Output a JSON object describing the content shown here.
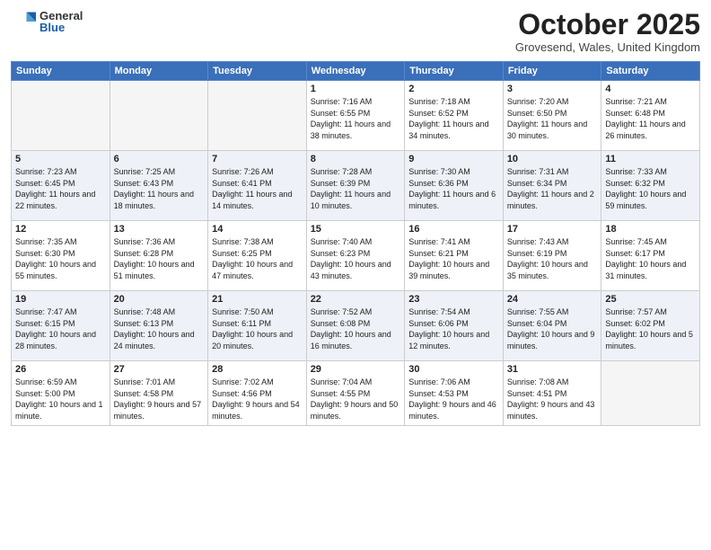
{
  "header": {
    "logo_general": "General",
    "logo_blue": "Blue",
    "month": "October 2025",
    "location": "Grovesend, Wales, United Kingdom"
  },
  "weekdays": [
    "Sunday",
    "Monday",
    "Tuesday",
    "Wednesday",
    "Thursday",
    "Friday",
    "Saturday"
  ],
  "weeks": [
    [
      {
        "day": "",
        "empty": true
      },
      {
        "day": "",
        "empty": true
      },
      {
        "day": "",
        "empty": true
      },
      {
        "day": "1",
        "sunrise": "7:16 AM",
        "sunset": "6:55 PM",
        "daylight": "11 hours and 38 minutes."
      },
      {
        "day": "2",
        "sunrise": "7:18 AM",
        "sunset": "6:52 PM",
        "daylight": "11 hours and 34 minutes."
      },
      {
        "day": "3",
        "sunrise": "7:20 AM",
        "sunset": "6:50 PM",
        "daylight": "11 hours and 30 minutes."
      },
      {
        "day": "4",
        "sunrise": "7:21 AM",
        "sunset": "6:48 PM",
        "daylight": "11 hours and 26 minutes."
      }
    ],
    [
      {
        "day": "5",
        "sunrise": "7:23 AM",
        "sunset": "6:45 PM",
        "daylight": "11 hours and 22 minutes."
      },
      {
        "day": "6",
        "sunrise": "7:25 AM",
        "sunset": "6:43 PM",
        "daylight": "11 hours and 18 minutes."
      },
      {
        "day": "7",
        "sunrise": "7:26 AM",
        "sunset": "6:41 PM",
        "daylight": "11 hours and 14 minutes."
      },
      {
        "day": "8",
        "sunrise": "7:28 AM",
        "sunset": "6:39 PM",
        "daylight": "11 hours and 10 minutes."
      },
      {
        "day": "9",
        "sunrise": "7:30 AM",
        "sunset": "6:36 PM",
        "daylight": "11 hours and 6 minutes."
      },
      {
        "day": "10",
        "sunrise": "7:31 AM",
        "sunset": "6:34 PM",
        "daylight": "11 hours and 2 minutes."
      },
      {
        "day": "11",
        "sunrise": "7:33 AM",
        "sunset": "6:32 PM",
        "daylight": "10 hours and 59 minutes."
      }
    ],
    [
      {
        "day": "12",
        "sunrise": "7:35 AM",
        "sunset": "6:30 PM",
        "daylight": "10 hours and 55 minutes."
      },
      {
        "day": "13",
        "sunrise": "7:36 AM",
        "sunset": "6:28 PM",
        "daylight": "10 hours and 51 minutes."
      },
      {
        "day": "14",
        "sunrise": "7:38 AM",
        "sunset": "6:25 PM",
        "daylight": "10 hours and 47 minutes."
      },
      {
        "day": "15",
        "sunrise": "7:40 AM",
        "sunset": "6:23 PM",
        "daylight": "10 hours and 43 minutes."
      },
      {
        "day": "16",
        "sunrise": "7:41 AM",
        "sunset": "6:21 PM",
        "daylight": "10 hours and 39 minutes."
      },
      {
        "day": "17",
        "sunrise": "7:43 AM",
        "sunset": "6:19 PM",
        "daylight": "10 hours and 35 minutes."
      },
      {
        "day": "18",
        "sunrise": "7:45 AM",
        "sunset": "6:17 PM",
        "daylight": "10 hours and 31 minutes."
      }
    ],
    [
      {
        "day": "19",
        "sunrise": "7:47 AM",
        "sunset": "6:15 PM",
        "daylight": "10 hours and 28 minutes."
      },
      {
        "day": "20",
        "sunrise": "7:48 AM",
        "sunset": "6:13 PM",
        "daylight": "10 hours and 24 minutes."
      },
      {
        "day": "21",
        "sunrise": "7:50 AM",
        "sunset": "6:11 PM",
        "daylight": "10 hours and 20 minutes."
      },
      {
        "day": "22",
        "sunrise": "7:52 AM",
        "sunset": "6:08 PM",
        "daylight": "10 hours and 16 minutes."
      },
      {
        "day": "23",
        "sunrise": "7:54 AM",
        "sunset": "6:06 PM",
        "daylight": "10 hours and 12 minutes."
      },
      {
        "day": "24",
        "sunrise": "7:55 AM",
        "sunset": "6:04 PM",
        "daylight": "10 hours and 9 minutes."
      },
      {
        "day": "25",
        "sunrise": "7:57 AM",
        "sunset": "6:02 PM",
        "daylight": "10 hours and 5 minutes."
      }
    ],
    [
      {
        "day": "26",
        "sunrise": "6:59 AM",
        "sunset": "5:00 PM",
        "daylight": "10 hours and 1 minute."
      },
      {
        "day": "27",
        "sunrise": "7:01 AM",
        "sunset": "4:58 PM",
        "daylight": "9 hours and 57 minutes."
      },
      {
        "day": "28",
        "sunrise": "7:02 AM",
        "sunset": "4:56 PM",
        "daylight": "9 hours and 54 minutes."
      },
      {
        "day": "29",
        "sunrise": "7:04 AM",
        "sunset": "4:55 PM",
        "daylight": "9 hours and 50 minutes."
      },
      {
        "day": "30",
        "sunrise": "7:06 AM",
        "sunset": "4:53 PM",
        "daylight": "9 hours and 46 minutes."
      },
      {
        "day": "31",
        "sunrise": "7:08 AM",
        "sunset": "4:51 PM",
        "daylight": "9 hours and 43 minutes."
      },
      {
        "day": "",
        "empty": true
      }
    ]
  ],
  "labels": {
    "sunrise": "Sunrise:",
    "sunset": "Sunset:",
    "daylight": "Daylight:"
  }
}
